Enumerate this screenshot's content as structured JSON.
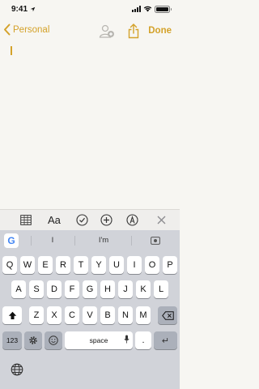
{
  "status_bar": {
    "time": "9:41",
    "location_arrow": "location-arrow-icon",
    "wifi": "wifi-icon",
    "battery": "battery-icon"
  },
  "nav": {
    "back_label": "Personal",
    "done_label": "Done",
    "accent_color": "#d4a22a",
    "icons": [
      "add-person-icon",
      "share-icon"
    ]
  },
  "format_toolbar": {
    "aa_label": "Aa",
    "icons": [
      "table-icon",
      "text-format-icon",
      "checklist-icon",
      "add-icon",
      "markup-icon",
      "close-icon"
    ]
  },
  "keyboard": {
    "suggestions": [
      "I",
      "I'm"
    ],
    "row1": [
      "Q",
      "W",
      "E",
      "R",
      "T",
      "Y",
      "U",
      "I",
      "O",
      "P"
    ],
    "row2": [
      "A",
      "S",
      "D",
      "F",
      "G",
      "H",
      "J",
      "K",
      "L"
    ],
    "row3": [
      "Z",
      "X",
      "C",
      "V",
      "B",
      "N",
      "M"
    ],
    "numbers_label": "123",
    "space_label": "space",
    "period_label": ".",
    "return_label": "↵"
  }
}
